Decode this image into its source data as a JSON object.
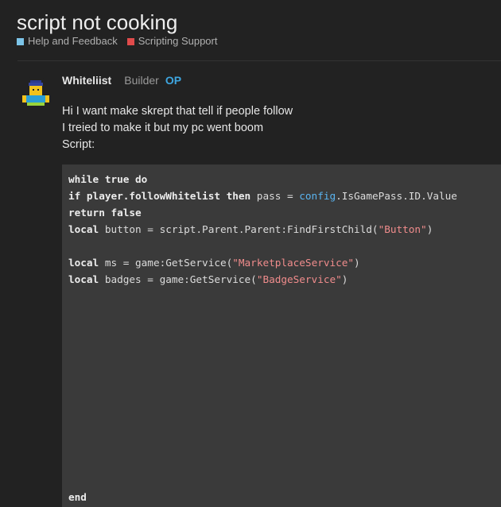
{
  "topic": {
    "title": "script not cooking",
    "categories": [
      {
        "label": "Help and Feedback",
        "color": "#7cc4e8"
      },
      {
        "label": "Scripting Support",
        "color": "#e04b4b"
      }
    ]
  },
  "post": {
    "username": "Whiteliist",
    "role": "Builder",
    "op_badge": "OP",
    "lines": [
      "Hi I want make skrept that tell if people follow",
      "I treied to make it but my pc went boom",
      "Script:"
    ],
    "code": {
      "l1_kw": "while true do",
      "l2_kw1": "if",
      "l2_a": " player.followWhitelist ",
      "l2_kw2": "then",
      "l2_b": " pass = ",
      "l2_blue": "config",
      "l2_c": ".IsGamePass.ID.Value",
      "l3_kw": "return false",
      "l4_kw": "local",
      "l4_a": " button = script.Parent.Parent:FindFirstChild(",
      "l4_str": "\"Button\"",
      "l4_b": ")",
      "l6_kw": "local",
      "l6_a": " ms = game:GetService(",
      "l6_str": "\"MarketplaceService\"",
      "l6_b": ")",
      "l7_kw": "local",
      "l7_a": " badges = game:GetService(",
      "l7_str": "\"BadgeService\"",
      "l7_b": ")",
      "last_kw": "end"
    }
  }
}
